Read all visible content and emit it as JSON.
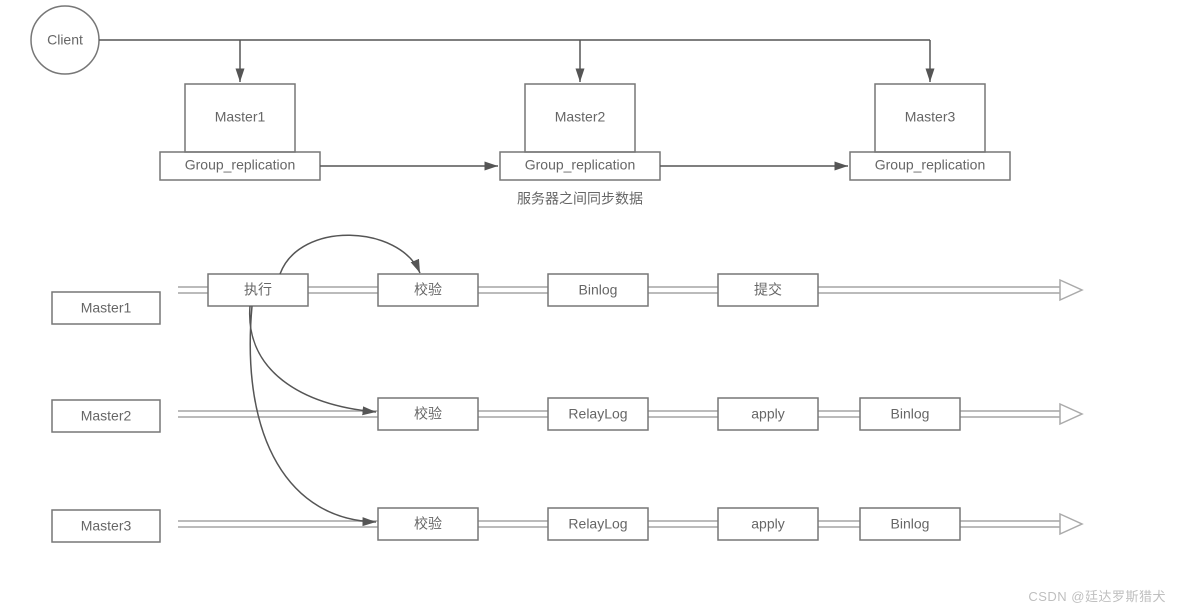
{
  "client": {
    "label": "Client"
  },
  "masters": [
    {
      "name": "Master1",
      "plugin": "Group_replication"
    },
    {
      "name": "Master2",
      "plugin": "Group_replication"
    },
    {
      "name": "Master3",
      "plugin": "Group_replication"
    }
  ],
  "sync_caption": "服务器之间同步数据",
  "lanes": [
    {
      "name": "Master1",
      "steps": [
        "执行",
        "校验",
        "Binlog",
        "提交"
      ]
    },
    {
      "name": "Master2",
      "steps": [
        "校验",
        "RelayLog",
        "apply",
        "Binlog"
      ]
    },
    {
      "name": "Master3",
      "steps": [
        "校验",
        "RelayLog",
        "apply",
        "Binlog"
      ]
    }
  ],
  "watermark": "CSDN @廷达罗斯猎犬"
}
